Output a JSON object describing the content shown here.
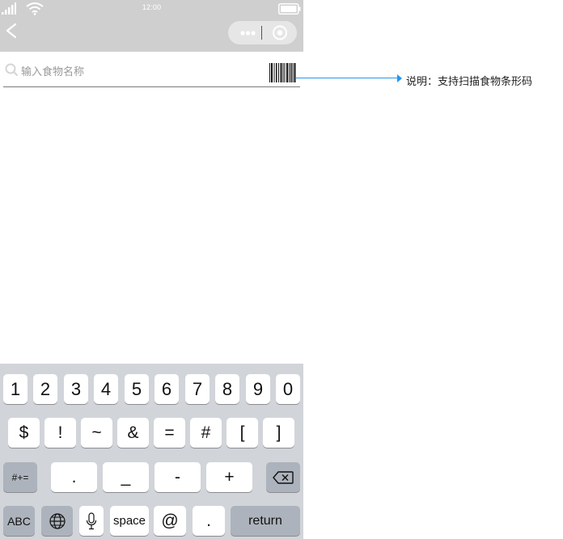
{
  "status_bar": {
    "time": "12:00"
  },
  "search": {
    "placeholder": "输入食物名称"
  },
  "annotation": {
    "text": "说明：支持扫描食物条形码"
  },
  "keyboard": {
    "row1": [
      "1",
      "2",
      "3",
      "4",
      "5",
      "6",
      "7",
      "8",
      "9",
      "0"
    ],
    "row2": [
      "$",
      "!",
      "~",
      "&",
      "=",
      "#",
      "[",
      "]"
    ],
    "row3": {
      "mode_switch": "#+=",
      "keys": [
        ".",
        "_",
        "-",
        "+"
      ]
    },
    "row4": {
      "abc": "ABC",
      "space": "space",
      "at": "@",
      "dot": ".",
      "return": "return"
    }
  },
  "colors": {
    "nav_background": "#cfcfcf",
    "keyboard_background": "#d1d4d9",
    "annotation_accent": "#2196f3"
  },
  "icons": [
    "signal-icon",
    "wifi-icon",
    "battery-icon",
    "back-arrow-icon",
    "more-dots-icon",
    "close-circle-icon",
    "search-icon",
    "barcode-icon",
    "globe-icon",
    "microphone-icon",
    "backspace-icon"
  ]
}
